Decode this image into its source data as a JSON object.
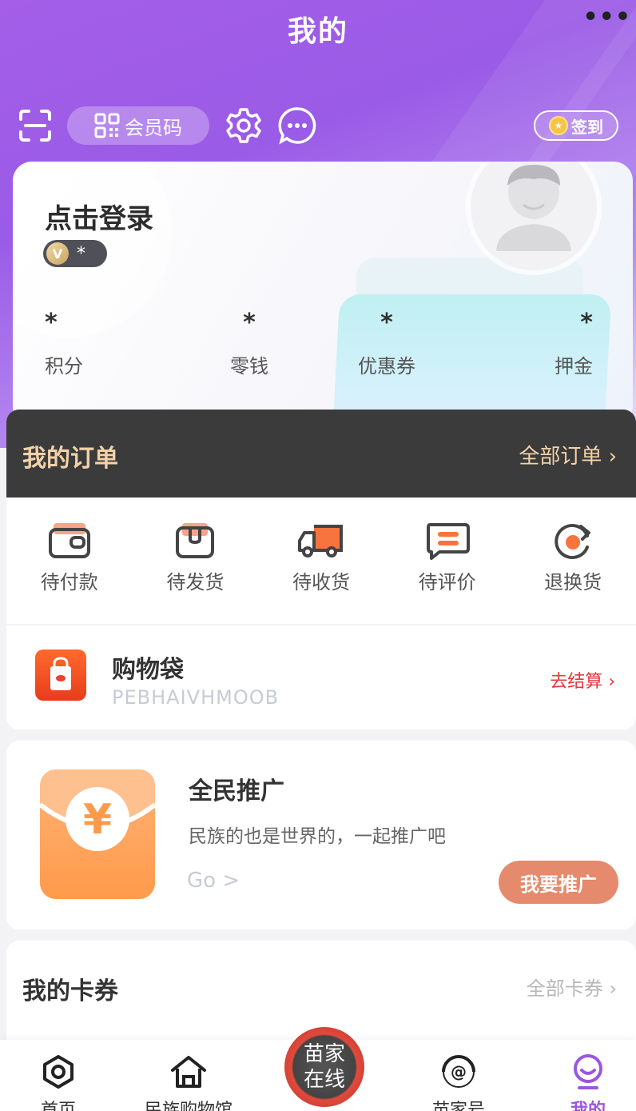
{
  "header": {
    "title": "我的",
    "more": "•••",
    "member_code_label": "会员码",
    "signin_label": "签到"
  },
  "profile": {
    "login_text": "点击登录",
    "vip_level": "*",
    "stats": [
      {
        "value": "*",
        "label": "积分"
      },
      {
        "value": "*",
        "label": "零钱"
      },
      {
        "value": "*",
        "label": "优惠券"
      },
      {
        "value": "*",
        "label": "押金"
      }
    ]
  },
  "orders": {
    "title": "我的订单",
    "all_label": "全部订单 ›",
    "items": [
      {
        "label": "待付款",
        "icon": "wallet-icon"
      },
      {
        "label": "待发货",
        "icon": "package-icon"
      },
      {
        "label": "待收货",
        "icon": "truck-icon"
      },
      {
        "label": "待评价",
        "icon": "comment-icon"
      },
      {
        "label": "退换货",
        "icon": "refresh-icon"
      }
    ]
  },
  "shopping_bag": {
    "title": "购物袋",
    "code": "PEBHAIVHMOOB",
    "checkout_label": "去结算 ›"
  },
  "promotion": {
    "title": "全民推广",
    "subtitle": "民族的也是世界的，一起推广吧",
    "go_label": "Go >",
    "button_label": "我要推广"
  },
  "coupons": {
    "title": "我的卡券",
    "all_label": "全部卡券 ›"
  },
  "tabbar": {
    "items": [
      {
        "label": "首页"
      },
      {
        "label": "民族购物馆"
      },
      {
        "label": "苗家在线"
      },
      {
        "label": "苗家号"
      },
      {
        "label": "我的"
      }
    ],
    "center_line1": "苗家",
    "center_line2": "在线"
  },
  "colors": {
    "brand_purple": "#9a5be6",
    "order_gold": "#f3d2a9",
    "checkout_red": "#e4393c",
    "promo_button": "#e58a6c"
  }
}
